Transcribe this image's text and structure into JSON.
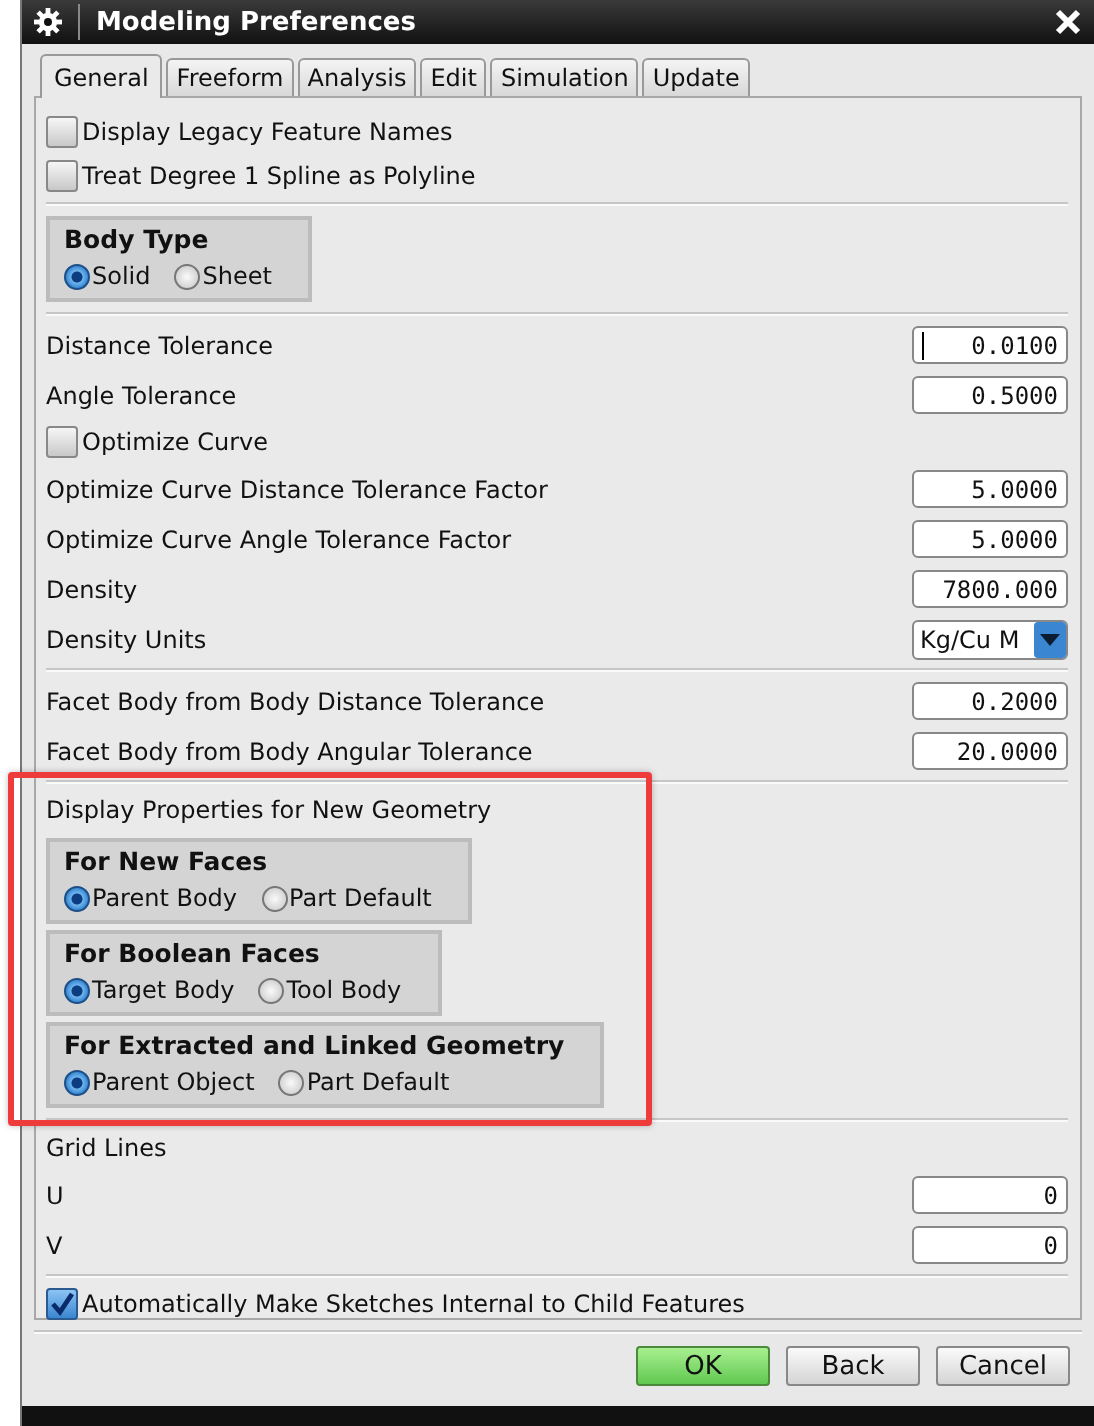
{
  "window": {
    "title": "Modeling Preferences"
  },
  "tabs": [
    {
      "label": "General",
      "selected": true
    },
    {
      "label": "Freeform",
      "selected": false
    },
    {
      "label": "Analysis",
      "selected": false
    },
    {
      "label": "Edit",
      "selected": false
    },
    {
      "label": "Simulation",
      "selected": false
    },
    {
      "label": "Update",
      "selected": false
    }
  ],
  "sections": [
    {
      "highlighted": false,
      "items": [
        {
          "kind": "checkbox",
          "label": "Display Legacy Feature Names",
          "checked": false
        },
        {
          "kind": "checkbox",
          "label": "Treat Degree 1 Spline as Polyline",
          "checked": false
        }
      ]
    },
    {
      "highlighted": false,
      "items": [
        {
          "kind": "group",
          "title": "Body Type",
          "options": [
            {
              "label": "Solid",
              "selected": true
            },
            {
              "label": "Sheet",
              "selected": false
            }
          ]
        }
      ]
    },
    {
      "highlighted": false,
      "items": [
        {
          "kind": "field",
          "label": "Distance Tolerance",
          "value": "0.0100",
          "focused": true
        },
        {
          "kind": "field",
          "label": "Angle Tolerance",
          "value": "0.5000",
          "focused": false
        },
        {
          "kind": "checkbox",
          "label": "Optimize Curve",
          "checked": false
        },
        {
          "kind": "field",
          "label": "Optimize Curve Distance Tolerance Factor",
          "value": "5.0000",
          "focused": false
        },
        {
          "kind": "field",
          "label": "Optimize Curve Angle Tolerance Factor",
          "value": "5.0000",
          "focused": false
        },
        {
          "kind": "field",
          "label": "Density",
          "value": "7800.000",
          "focused": false
        },
        {
          "kind": "dropdown",
          "label": "Density Units",
          "value": "Kg/Cu M"
        }
      ]
    },
    {
      "highlighted": false,
      "items": [
        {
          "kind": "field",
          "label": "Facet Body from Body Distance Tolerance",
          "value": "0.2000",
          "focused": false
        },
        {
          "kind": "field",
          "label": "Facet Body from Body Angular Tolerance",
          "value": "20.0000",
          "focused": false
        }
      ]
    },
    {
      "highlighted": true,
      "items": [
        {
          "kind": "heading",
          "label": "Display Properties for New Geometry"
        },
        {
          "kind": "group",
          "title": "For New Faces",
          "options": [
            {
              "label": "Parent Body",
              "selected": true
            },
            {
              "label": "Part Default",
              "selected": false
            }
          ]
        },
        {
          "kind": "group",
          "title": "For Boolean Faces",
          "options": [
            {
              "label": "Target Body",
              "selected": true
            },
            {
              "label": "Tool Body",
              "selected": false
            }
          ]
        },
        {
          "kind": "group",
          "title": "For Extracted and Linked Geometry",
          "options": [
            {
              "label": "Parent Object",
              "selected": true
            },
            {
              "label": "Part Default",
              "selected": false
            }
          ]
        }
      ]
    },
    {
      "highlighted": false,
      "items": [
        {
          "kind": "heading",
          "label": "Grid Lines"
        },
        {
          "kind": "field",
          "label": "U",
          "value": "0",
          "focused": false
        },
        {
          "kind": "field",
          "label": "V",
          "value": "0",
          "focused": false
        }
      ]
    },
    {
      "highlighted": false,
      "items": [
        {
          "kind": "checkbox",
          "label": "Automatically Make Sketches Internal to Child Features",
          "checked": true
        }
      ]
    }
  ],
  "buttons": [
    {
      "label": "OK",
      "default": true
    },
    {
      "label": "Back",
      "default": false
    },
    {
      "label": "Cancel",
      "default": false
    }
  ]
}
